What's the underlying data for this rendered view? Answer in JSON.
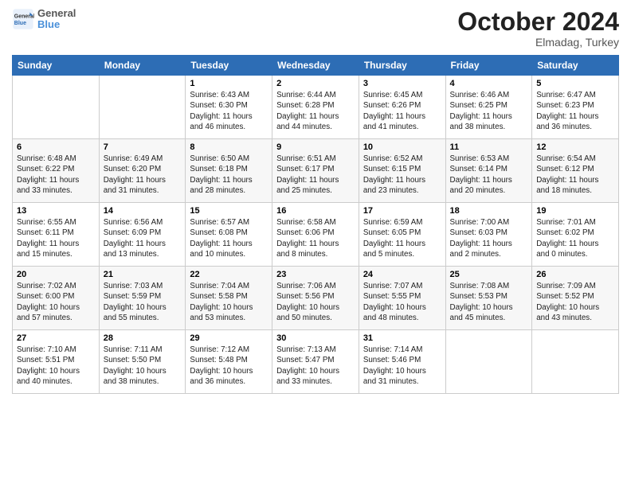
{
  "header": {
    "logo_line1": "General",
    "logo_line2": "Blue",
    "month": "October 2024",
    "location": "Elmadag, Turkey"
  },
  "days_of_week": [
    "Sunday",
    "Monday",
    "Tuesday",
    "Wednesday",
    "Thursday",
    "Friday",
    "Saturday"
  ],
  "weeks": [
    [
      {
        "day": "",
        "sunrise": "",
        "sunset": "",
        "daylight": ""
      },
      {
        "day": "",
        "sunrise": "",
        "sunset": "",
        "daylight": ""
      },
      {
        "day": "1",
        "sunrise": "Sunrise: 6:43 AM",
        "sunset": "Sunset: 6:30 PM",
        "daylight": "Daylight: 11 hours and 46 minutes."
      },
      {
        "day": "2",
        "sunrise": "Sunrise: 6:44 AM",
        "sunset": "Sunset: 6:28 PM",
        "daylight": "Daylight: 11 hours and 44 minutes."
      },
      {
        "day": "3",
        "sunrise": "Sunrise: 6:45 AM",
        "sunset": "Sunset: 6:26 PM",
        "daylight": "Daylight: 11 hours and 41 minutes."
      },
      {
        "day": "4",
        "sunrise": "Sunrise: 6:46 AM",
        "sunset": "Sunset: 6:25 PM",
        "daylight": "Daylight: 11 hours and 38 minutes."
      },
      {
        "day": "5",
        "sunrise": "Sunrise: 6:47 AM",
        "sunset": "Sunset: 6:23 PM",
        "daylight": "Daylight: 11 hours and 36 minutes."
      }
    ],
    [
      {
        "day": "6",
        "sunrise": "Sunrise: 6:48 AM",
        "sunset": "Sunset: 6:22 PM",
        "daylight": "Daylight: 11 hours and 33 minutes."
      },
      {
        "day": "7",
        "sunrise": "Sunrise: 6:49 AM",
        "sunset": "Sunset: 6:20 PM",
        "daylight": "Daylight: 11 hours and 31 minutes."
      },
      {
        "day": "8",
        "sunrise": "Sunrise: 6:50 AM",
        "sunset": "Sunset: 6:18 PM",
        "daylight": "Daylight: 11 hours and 28 minutes."
      },
      {
        "day": "9",
        "sunrise": "Sunrise: 6:51 AM",
        "sunset": "Sunset: 6:17 PM",
        "daylight": "Daylight: 11 hours and 25 minutes."
      },
      {
        "day": "10",
        "sunrise": "Sunrise: 6:52 AM",
        "sunset": "Sunset: 6:15 PM",
        "daylight": "Daylight: 11 hours and 23 minutes."
      },
      {
        "day": "11",
        "sunrise": "Sunrise: 6:53 AM",
        "sunset": "Sunset: 6:14 PM",
        "daylight": "Daylight: 11 hours and 20 minutes."
      },
      {
        "day": "12",
        "sunrise": "Sunrise: 6:54 AM",
        "sunset": "Sunset: 6:12 PM",
        "daylight": "Daylight: 11 hours and 18 minutes."
      }
    ],
    [
      {
        "day": "13",
        "sunrise": "Sunrise: 6:55 AM",
        "sunset": "Sunset: 6:11 PM",
        "daylight": "Daylight: 11 hours and 15 minutes."
      },
      {
        "day": "14",
        "sunrise": "Sunrise: 6:56 AM",
        "sunset": "Sunset: 6:09 PM",
        "daylight": "Daylight: 11 hours and 13 minutes."
      },
      {
        "day": "15",
        "sunrise": "Sunrise: 6:57 AM",
        "sunset": "Sunset: 6:08 PM",
        "daylight": "Daylight: 11 hours and 10 minutes."
      },
      {
        "day": "16",
        "sunrise": "Sunrise: 6:58 AM",
        "sunset": "Sunset: 6:06 PM",
        "daylight": "Daylight: 11 hours and 8 minutes."
      },
      {
        "day": "17",
        "sunrise": "Sunrise: 6:59 AM",
        "sunset": "Sunset: 6:05 PM",
        "daylight": "Daylight: 11 hours and 5 minutes."
      },
      {
        "day": "18",
        "sunrise": "Sunrise: 7:00 AM",
        "sunset": "Sunset: 6:03 PM",
        "daylight": "Daylight: 11 hours and 2 minutes."
      },
      {
        "day": "19",
        "sunrise": "Sunrise: 7:01 AM",
        "sunset": "Sunset: 6:02 PM",
        "daylight": "Daylight: 11 hours and 0 minutes."
      }
    ],
    [
      {
        "day": "20",
        "sunrise": "Sunrise: 7:02 AM",
        "sunset": "Sunset: 6:00 PM",
        "daylight": "Daylight: 10 hours and 57 minutes."
      },
      {
        "day": "21",
        "sunrise": "Sunrise: 7:03 AM",
        "sunset": "Sunset: 5:59 PM",
        "daylight": "Daylight: 10 hours and 55 minutes."
      },
      {
        "day": "22",
        "sunrise": "Sunrise: 7:04 AM",
        "sunset": "Sunset: 5:58 PM",
        "daylight": "Daylight: 10 hours and 53 minutes."
      },
      {
        "day": "23",
        "sunrise": "Sunrise: 7:06 AM",
        "sunset": "Sunset: 5:56 PM",
        "daylight": "Daylight: 10 hours and 50 minutes."
      },
      {
        "day": "24",
        "sunrise": "Sunrise: 7:07 AM",
        "sunset": "Sunset: 5:55 PM",
        "daylight": "Daylight: 10 hours and 48 minutes."
      },
      {
        "day": "25",
        "sunrise": "Sunrise: 7:08 AM",
        "sunset": "Sunset: 5:53 PM",
        "daylight": "Daylight: 10 hours and 45 minutes."
      },
      {
        "day": "26",
        "sunrise": "Sunrise: 7:09 AM",
        "sunset": "Sunset: 5:52 PM",
        "daylight": "Daylight: 10 hours and 43 minutes."
      }
    ],
    [
      {
        "day": "27",
        "sunrise": "Sunrise: 7:10 AM",
        "sunset": "Sunset: 5:51 PM",
        "daylight": "Daylight: 10 hours and 40 minutes."
      },
      {
        "day": "28",
        "sunrise": "Sunrise: 7:11 AM",
        "sunset": "Sunset: 5:50 PM",
        "daylight": "Daylight: 10 hours and 38 minutes."
      },
      {
        "day": "29",
        "sunrise": "Sunrise: 7:12 AM",
        "sunset": "Sunset: 5:48 PM",
        "daylight": "Daylight: 10 hours and 36 minutes."
      },
      {
        "day": "30",
        "sunrise": "Sunrise: 7:13 AM",
        "sunset": "Sunset: 5:47 PM",
        "daylight": "Daylight: 10 hours and 33 minutes."
      },
      {
        "day": "31",
        "sunrise": "Sunrise: 7:14 AM",
        "sunset": "Sunset: 5:46 PM",
        "daylight": "Daylight: 10 hours and 31 minutes."
      },
      {
        "day": "",
        "sunrise": "",
        "sunset": "",
        "daylight": ""
      },
      {
        "day": "",
        "sunrise": "",
        "sunset": "",
        "daylight": ""
      }
    ]
  ]
}
